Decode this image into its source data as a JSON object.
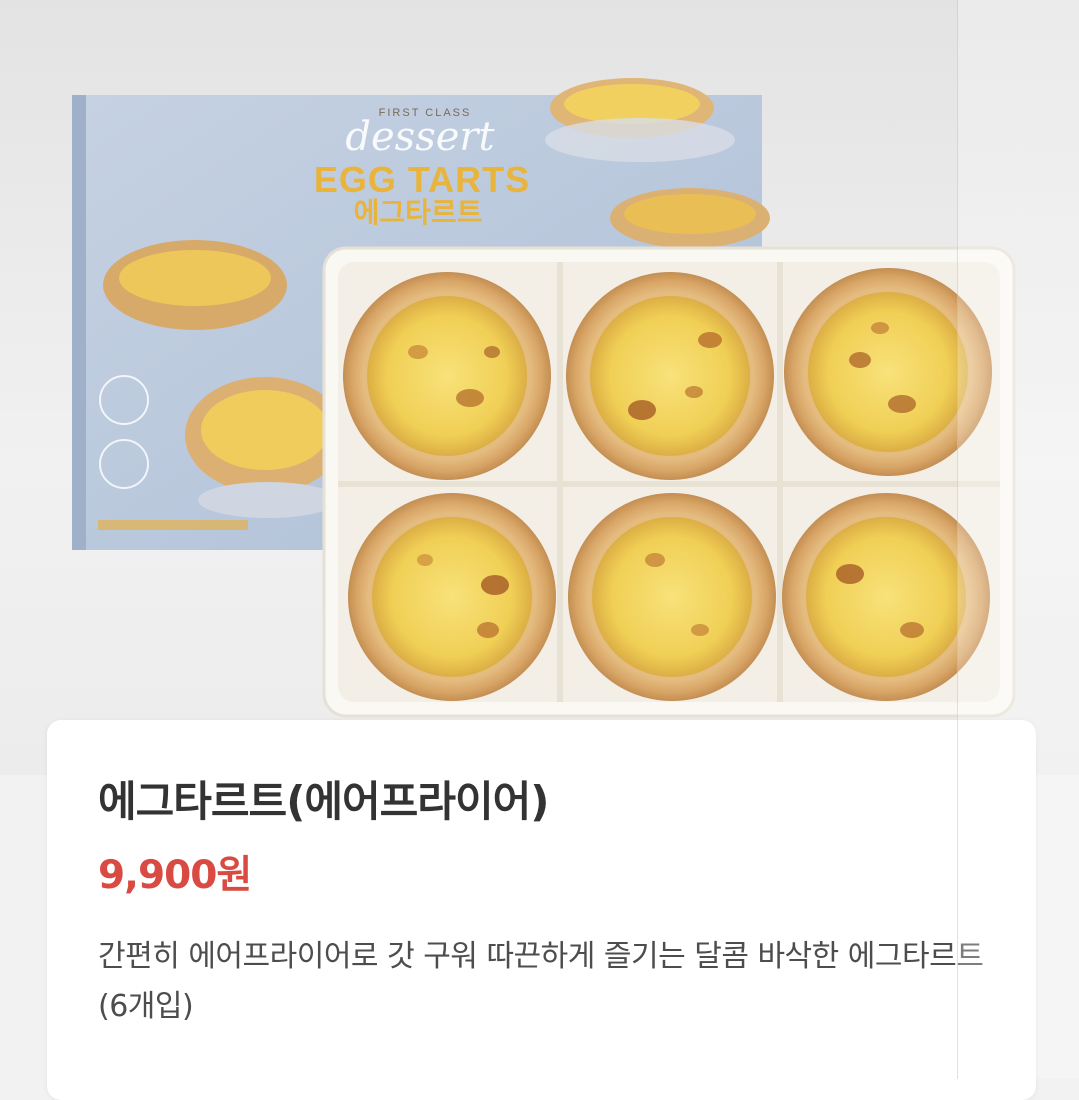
{
  "product_image": {
    "box_brand": "FIRST CLASS",
    "box_script": "dessert",
    "box_title_en": "EGG TARTS",
    "box_title_ko": "에그타르트"
  },
  "product": {
    "name": "에그타르트(에어프라이어)",
    "price": "9,900원",
    "description": "간편히 에어프라이어로 갓 구워 따끈하게 즐기는 달콤 바삭한 에그타르트(6개입)"
  },
  "colors": {
    "price": "#d94b42",
    "title": "#333333",
    "description": "#4d4d4d",
    "box": "#b9c8dd"
  }
}
